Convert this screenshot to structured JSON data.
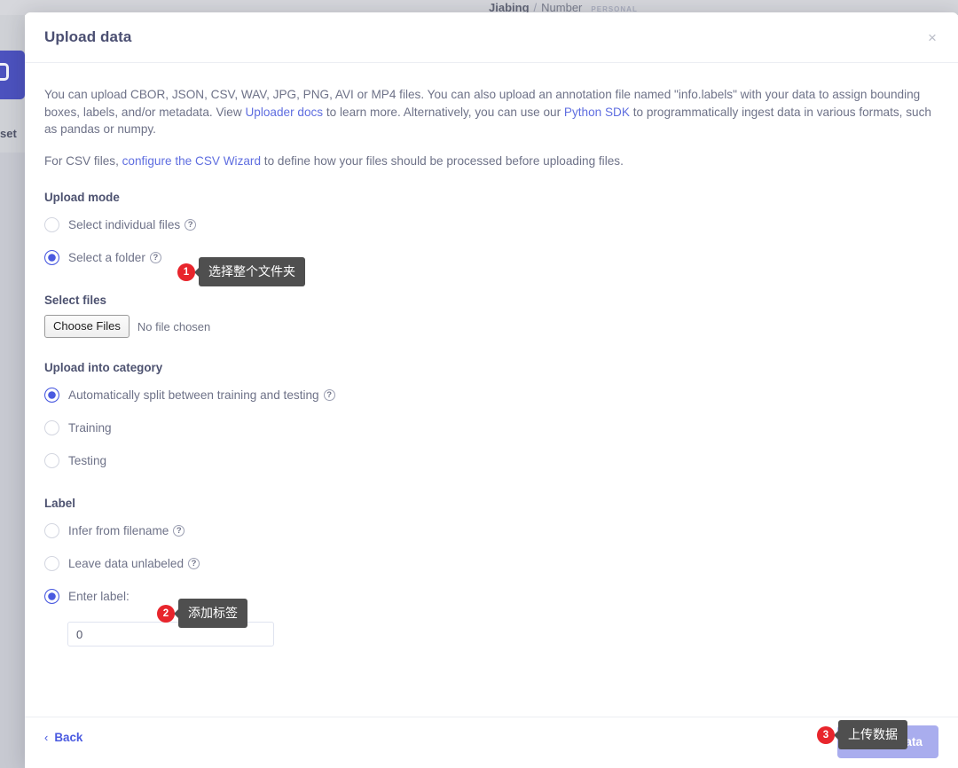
{
  "background": {
    "breadcrumb": {
      "owner": "Jiabing",
      "separator": "/",
      "project": "Number",
      "badge": "PERSONAL"
    },
    "left_label": "set",
    "blue_button_name": "sidebar-action-button"
  },
  "modal": {
    "title": "Upload data",
    "close_label": "×",
    "description": {
      "part1": "You can upload CBOR, JSON, CSV, WAV, JPG, PNG, AVI or MP4 files. You can also upload an annotation file named \"info.labels\" with your data to assign bounding boxes, labels, and/or metadata. View ",
      "link1": "Uploader docs",
      "part2": " to learn more. Alternatively, you can use our ",
      "link2": "Python SDK",
      "part3": " to programmatically ingest data in various formats, such as pandas or numpy."
    },
    "csv_note": {
      "part1": "For CSV files, ",
      "link": "configure the CSV Wizard",
      "part2": " to define how your files should be processed before uploading files."
    },
    "upload_mode": {
      "title": "Upload mode",
      "options": [
        {
          "label": "Select individual files",
          "checked": false,
          "help": "?"
        },
        {
          "label": "Select a folder",
          "checked": true,
          "help": "?"
        }
      ]
    },
    "select_files": {
      "title": "Select files",
      "button_label": "Choose Files",
      "status": "No file chosen"
    },
    "upload_category": {
      "title": "Upload into category",
      "options": [
        {
          "label": "Automatically split between training and testing",
          "checked": true,
          "help": "?"
        },
        {
          "label": "Training",
          "checked": false,
          "help": ""
        },
        {
          "label": "Testing",
          "checked": false,
          "help": ""
        }
      ]
    },
    "label_section": {
      "title": "Label",
      "options": [
        {
          "label": "Infer from filename",
          "checked": false,
          "help": "?"
        },
        {
          "label": "Leave data unlabeled",
          "checked": false,
          "help": "?"
        },
        {
          "label": "Enter label:",
          "checked": true,
          "help": ""
        }
      ],
      "input_value": "0",
      "input_placeholder": ""
    },
    "footer": {
      "back_label": "Back",
      "back_chevron": "‹",
      "upload_label": "Upload data"
    }
  },
  "annotations": [
    {
      "number": "1",
      "text": "选择整个文件夹"
    },
    {
      "number": "2",
      "text": "添加标签"
    },
    {
      "number": "3",
      "text": "上传数据"
    }
  ],
  "colors": {
    "accent": "#4a5ae0",
    "link": "#5f6ee0",
    "badge_red": "#e8252c",
    "bubble_gray": "#4f4f4f",
    "upload_button": "#a9adee"
  }
}
